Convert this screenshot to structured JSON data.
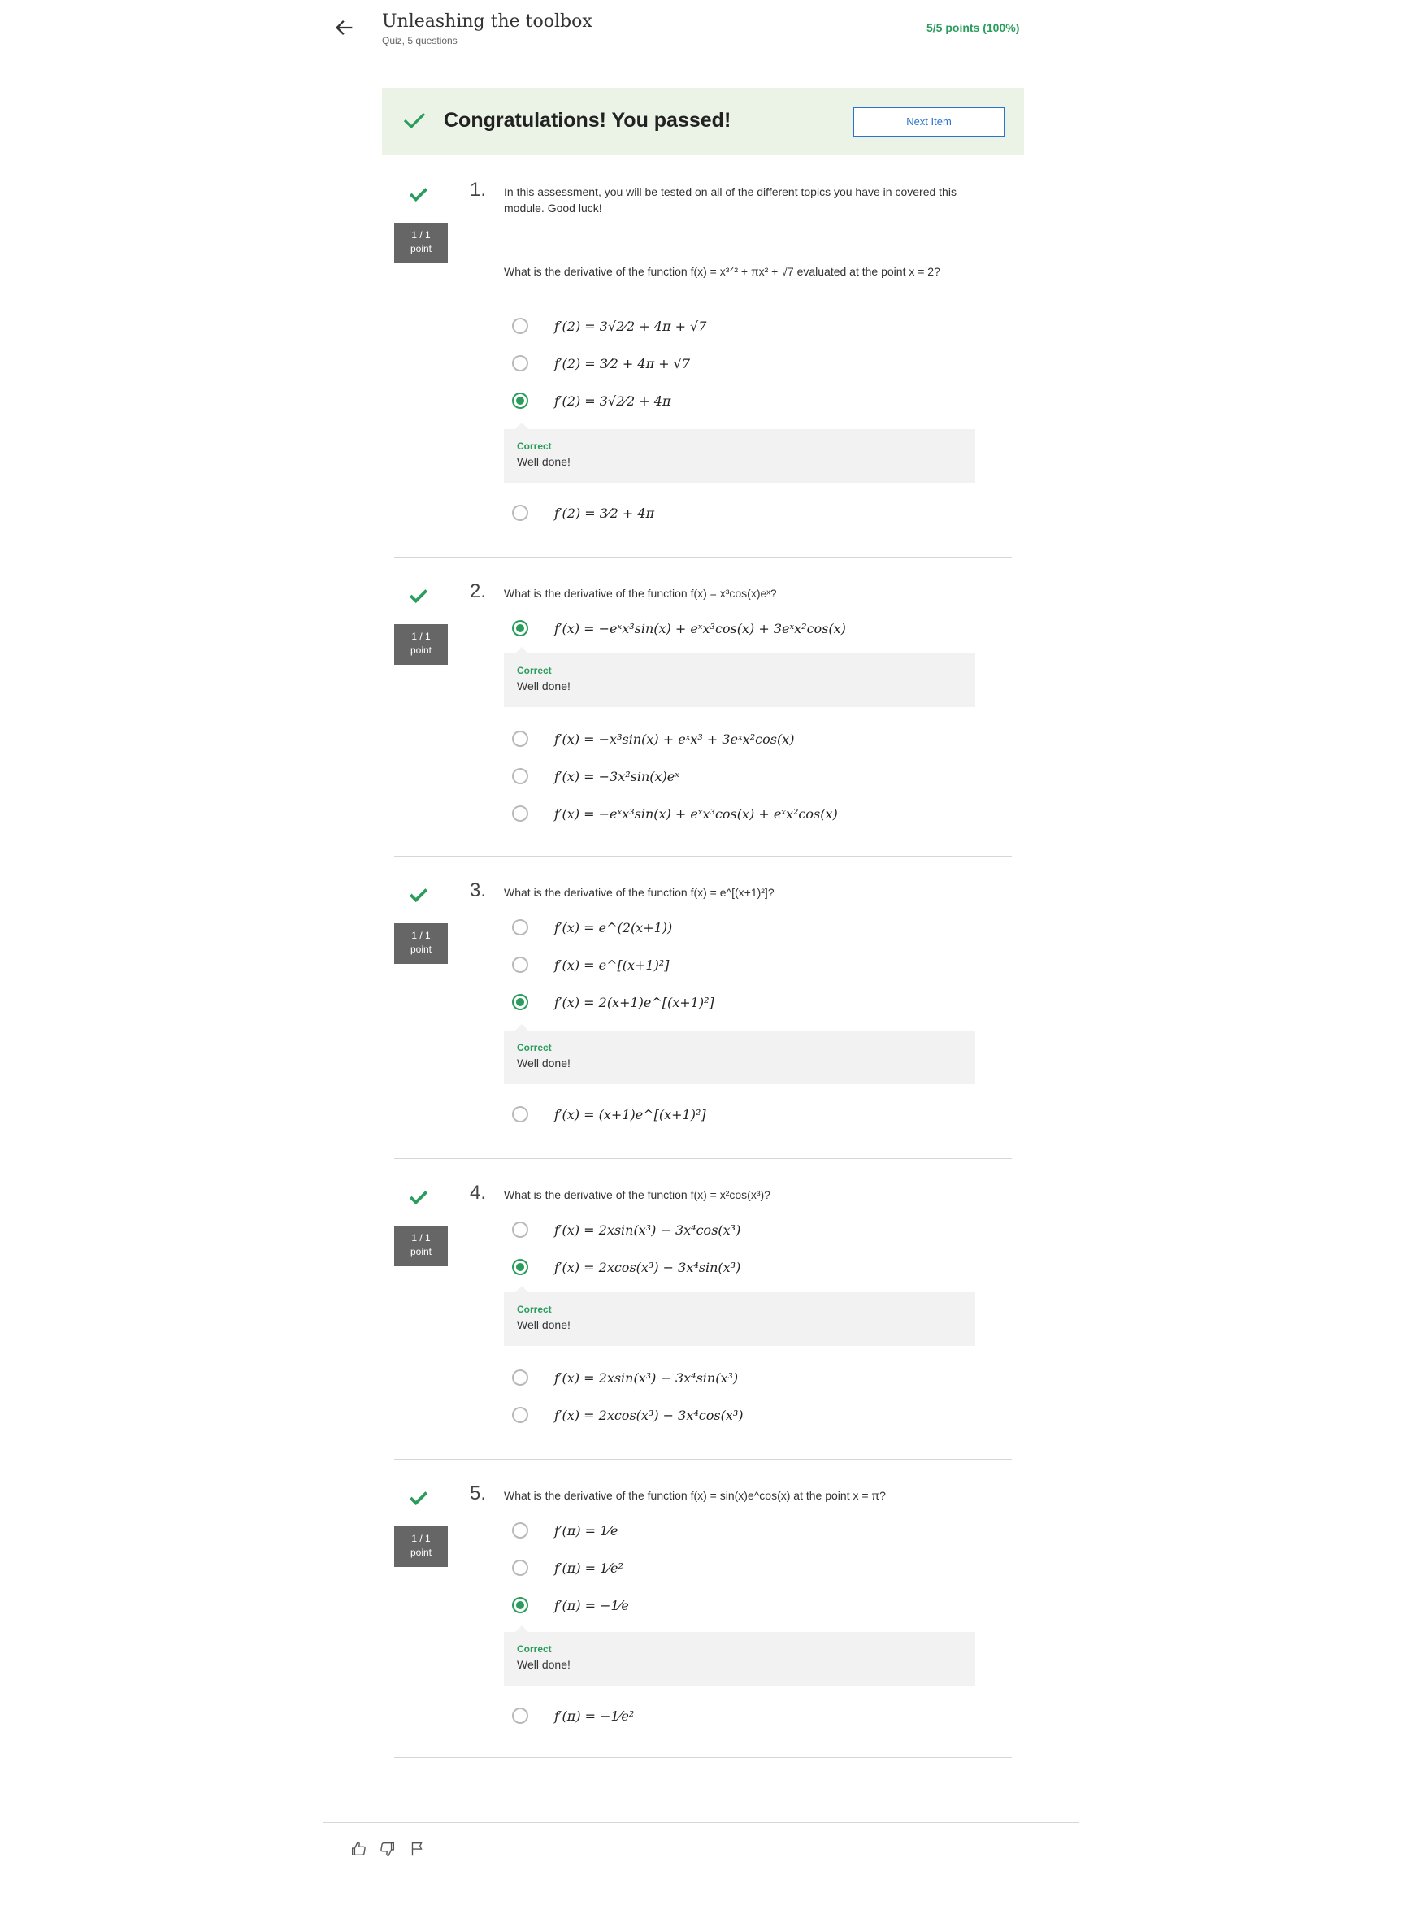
{
  "header": {
    "title": "Unleashing the toolbox",
    "subtitle": "Quiz, 5 questions",
    "score": "5/5 points (100%)"
  },
  "banner": {
    "message": "Congratulations! You passed!",
    "next_label": "Next Item"
  },
  "questions": [
    {
      "number": "1.",
      "badge_top": "1 / 1",
      "badge_bottom": "point",
      "intro": "In this assessment, you will be tested on all of the different topics you have in covered this module. Good luck!",
      "text": "What is the derivative of the function f(x) = x³ᐟ² + πx² + √7 evaluated at the point x = 2?",
      "options": [
        "f′(2) = 3√2⁄2 + 4π + √7",
        "f′(2) = 3⁄2 + 4π + √7",
        "f′(2) = 3√2⁄2 + 4π",
        "f′(2) = 3⁄2 + 4π"
      ],
      "selected": 2,
      "feedback_title": "Correct",
      "feedback_text": "Well done!"
    },
    {
      "number": "2.",
      "badge_top": "1 / 1",
      "badge_bottom": "point",
      "text": "What is the derivative of the function f(x) = x³cos(x)eˣ?",
      "options": [
        "f′(x) = −eˣx³sin(x) + eˣx³cos(x) + 3eˣx²cos(x)",
        "f′(x) = −x³sin(x) + eˣx³ + 3eˣx²cos(x)",
        "f′(x) = −3x²sin(x)eˣ",
        "f′(x) = −eˣx³sin(x) + eˣx³cos(x) + eˣx²cos(x)"
      ],
      "selected": 0,
      "feedback_title": "Correct",
      "feedback_text": "Well done!"
    },
    {
      "number": "3.",
      "badge_top": "1 / 1",
      "badge_bottom": "point",
      "text": "What is the derivative of the function f(x) = e^[(x+1)²]?",
      "options": [
        "f′(x) = e^(2(x+1))",
        "f′(x) = e^[(x+1)²]",
        "f′(x) = 2(x+1)e^[(x+1)²]",
        "f′(x) = (x+1)e^[(x+1)²]"
      ],
      "selected": 2,
      "feedback_title": "Correct",
      "feedback_text": "Well done!"
    },
    {
      "number": "4.",
      "badge_top": "1 / 1",
      "badge_bottom": "point",
      "text": "What is the derivative of the function f(x) = x²cos(x³)?",
      "options": [
        "f′(x) = 2xsin(x³) − 3x⁴cos(x³)",
        "f′(x) = 2xcos(x³) − 3x⁴sin(x³)",
        "f′(x) = 2xsin(x³) − 3x⁴sin(x³)",
        "f′(x) = 2xcos(x³) − 3x⁴cos(x³)"
      ],
      "selected": 1,
      "feedback_title": "Correct",
      "feedback_text": "Well done!"
    },
    {
      "number": "5.",
      "badge_top": "1 / 1",
      "badge_bottom": "point",
      "text": "What is the derivative of the function f(x) = sin(x)e^cos(x) at the point x = π?",
      "options": [
        "f′(π) = 1⁄e",
        "f′(π) = 1⁄e²",
        "f′(π) = −1⁄e",
        "f′(π) = −1⁄e²"
      ],
      "selected": 2,
      "feedback_title": "Correct",
      "feedback_text": "Well done!"
    }
  ],
  "colors": {
    "success": "#2a9d5c",
    "banner_bg": "#ebf3e6",
    "link": "#2a73cc",
    "badge": "#666666"
  },
  "icons": {
    "back": "arrow-left-icon",
    "check": "check-icon",
    "like": "thumbs-up-icon",
    "dislike": "thumbs-down-icon",
    "flag": "flag-icon"
  }
}
